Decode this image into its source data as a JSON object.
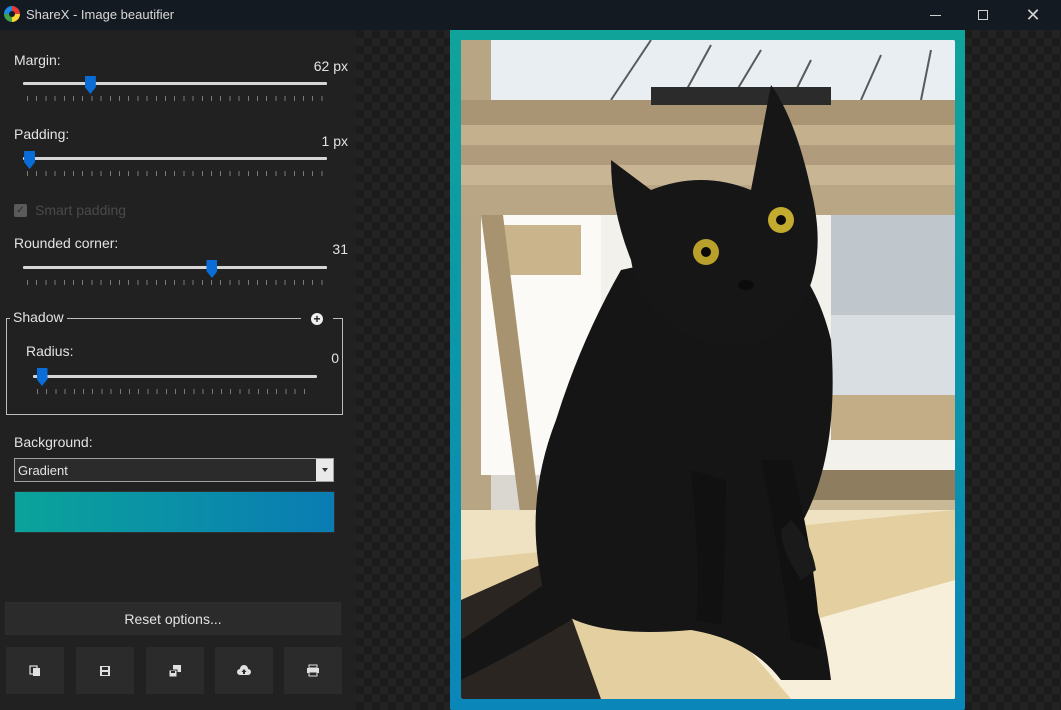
{
  "window": {
    "title": "ShareX - Image beautifier",
    "controls": {
      "minimize": "—",
      "maximize": "",
      "close": "✕"
    }
  },
  "margin": {
    "label": "Margin:",
    "value_text": "62 px",
    "value": 0.22
  },
  "padding": {
    "label": "Padding:",
    "value_text": "1 px",
    "value": 0.02
  },
  "smart_padding": {
    "label": "Smart padding",
    "checked": true
  },
  "rounded_corner": {
    "label": "Rounded corner:",
    "value_text": "31",
    "value": 0.62
  },
  "shadow": {
    "group_label": "Shadow",
    "radius": {
      "label": "Radius:",
      "value_text": "0",
      "value": 0.03
    }
  },
  "background": {
    "label": "Background:",
    "selected": "Gradient",
    "gradient_colors": [
      "#0aa39a",
      "#0a7cb4"
    ]
  },
  "actions": {
    "reset_label": "Reset options...",
    "tools": [
      "copy-icon",
      "save-icon",
      "save-as-icon",
      "upload-icon",
      "print-icon"
    ]
  },
  "colors": {
    "accent": "#0a6cd6",
    "border_gradient_top": "#10a39a",
    "border_gradient_bottom": "#0a86b8"
  }
}
